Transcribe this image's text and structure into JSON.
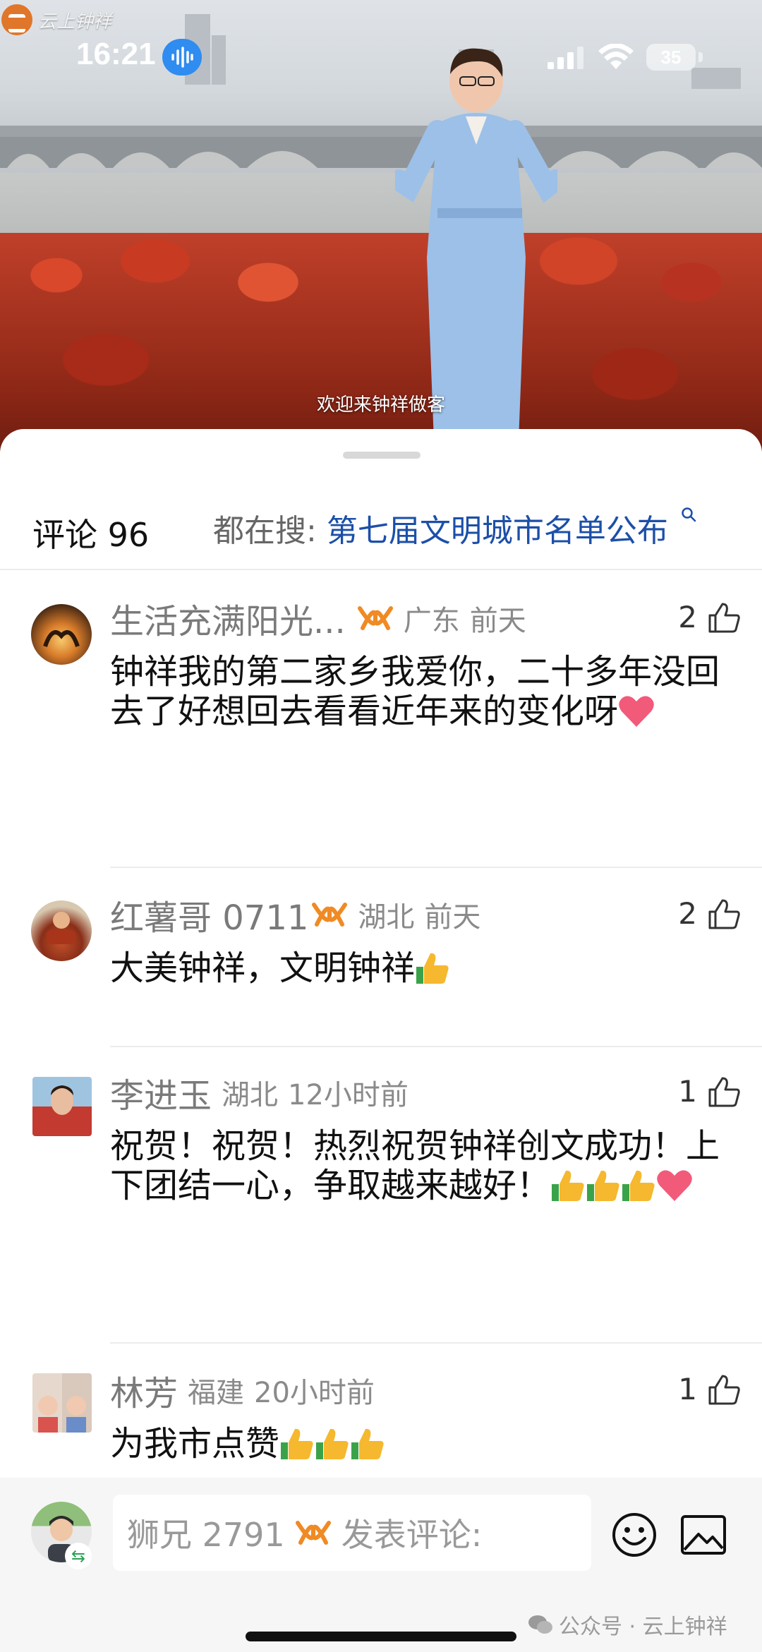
{
  "video": {
    "logo_text": "云上钟祥",
    "subtitle": "欢迎来钟祥做客"
  },
  "status_bar": {
    "time": "16:21",
    "battery": "35"
  },
  "comments_header": {
    "count_label": "评论 96",
    "search_prefix": "都在搜:",
    "search_keyword": "第七届文明城市名单公布"
  },
  "comments": [
    {
      "name": "生活充满阳光...",
      "region": "广东",
      "time": "前天",
      "likes": "2",
      "text": "钟祥我的第二家乡我爱你，二十多年没回去了好想回去看看近年来的变化呀",
      "emojis": [
        "heart"
      ]
    },
    {
      "name": "红薯哥 0711",
      "region": "湖北",
      "time": "前天",
      "likes": "2",
      "text": "大美钟祥，文明钟祥",
      "emojis": [
        "thumbs-up"
      ]
    },
    {
      "name": "李进玉",
      "region": "湖北",
      "time": "12小时前",
      "likes": "1",
      "text": "祝贺！祝贺！热烈祝贺钟祥创文成功！上下团结一心，争取越来越好！",
      "emojis": [
        "thumbs-up",
        "thumbs-up",
        "thumbs-up",
        "heart"
      ]
    },
    {
      "name": "林芳",
      "region": "福建",
      "time": "20小时前",
      "likes": "1",
      "text": "为我市点赞",
      "emojis": [
        "thumbs-up",
        "thumbs-up",
        "thumbs-up"
      ]
    }
  ],
  "composer": {
    "nickname": "狮兄 2791",
    "placeholder": "发表评论:"
  },
  "watermark": "公众号 · 云上钟祥",
  "colors": {
    "keyword_blue": "#1c4fa8",
    "badge_orange": "#f08a24",
    "heart_pink": "#f25a7a",
    "thumb_yellow": "#f5b82e",
    "thumb_green": "#3aa34a"
  }
}
